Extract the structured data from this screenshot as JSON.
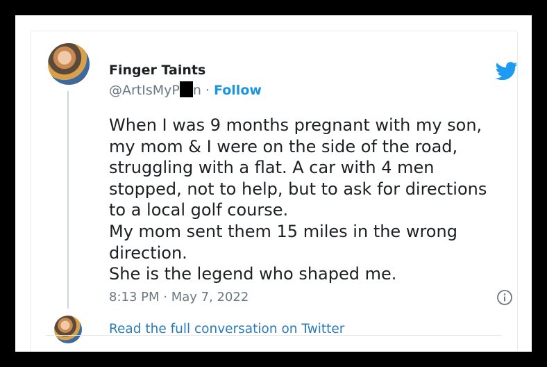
{
  "user": {
    "name": "Finger Taints",
    "handle_prefix": "@ArtIsMyP",
    "handle_suffix": "n",
    "separator": " · ",
    "follow_label": "Follow"
  },
  "tweet": {
    "lines": [
      "When I was 9 months pregnant with my son,",
      "my mom & I were on the side of the road,",
      "struggling with a flat. A car with 4 men",
      "stopped, not to help, but to ask for directions",
      "to a local golf course.",
      "My mom sent them 15 miles in the wrong",
      "direction.",
      "She is the legend who shaped me."
    ],
    "timestamp": "8:13 PM · May 7, 2022"
  },
  "footer": {
    "read_link": "Read the full conversation on Twitter"
  },
  "icons": {
    "brand": "twitter-bird-icon",
    "info": "info-icon"
  },
  "colors": {
    "brand_blue": "#1d9bf0",
    "link_blue": "#2b7bb9",
    "follow_blue": "#1b95e0",
    "text": "#1c2022",
    "muted": "#697882"
  }
}
